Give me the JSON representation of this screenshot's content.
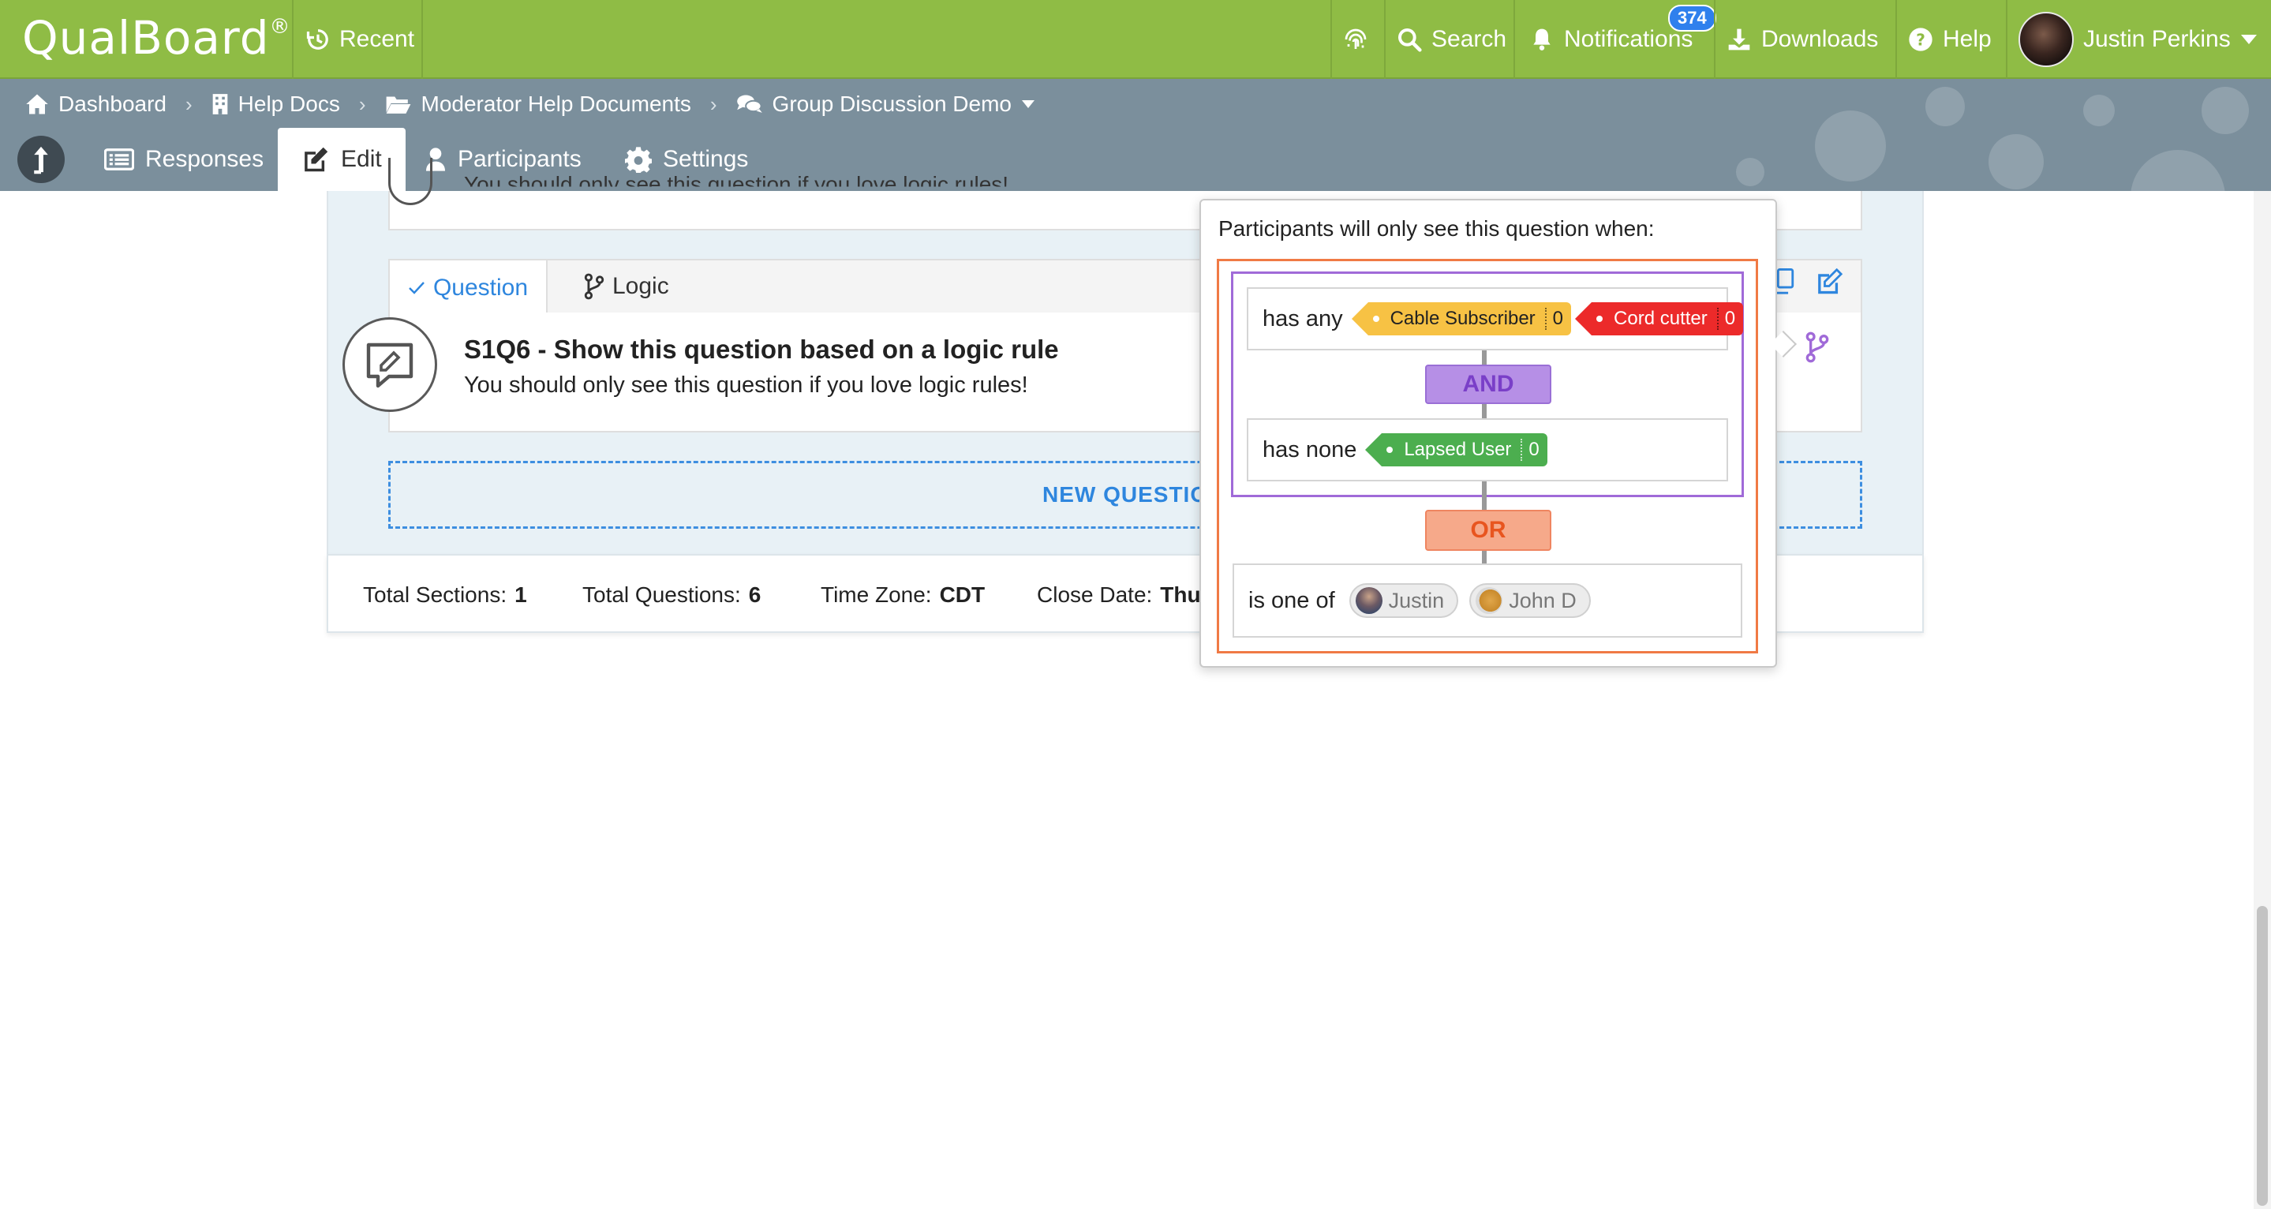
{
  "app": {
    "logo": "QualBoard",
    "logo_mark": "®"
  },
  "topbar": {
    "recent": "Recent",
    "search": "Search",
    "notifications": "Notifications",
    "notifications_count": "374",
    "downloads": "Downloads",
    "help": "Help",
    "user_name": "Justin Perkins"
  },
  "breadcrumb": [
    {
      "label": "Dashboard",
      "icon": "home-icon"
    },
    {
      "label": "Help Docs",
      "icon": "building-icon"
    },
    {
      "label": "Moderator Help Documents",
      "icon": "folder-open-icon"
    },
    {
      "label": "Group Discussion Demo",
      "icon": "comments-icon"
    }
  ],
  "tabs": {
    "responses": "Responses",
    "edit": "Edit",
    "participants": "Participants",
    "settings": "Settings",
    "active": "edit"
  },
  "previous_question": {
    "text": "You should only see this question if you love logic rules!"
  },
  "question": {
    "tab_question": "Question",
    "tab_logic": "Logic",
    "title": "S1Q6 - Show this question based on a logic rule",
    "subtitle": "You should only see this question if you love logic rules!"
  },
  "new_question": {
    "label": "NEW QUESTION"
  },
  "footer": {
    "sections_label": "Total Sections:",
    "sections_value": "1",
    "questions_label": "Total Questions:",
    "questions_value": "6",
    "timezone_label": "Time Zone:",
    "timezone_value": "CDT",
    "close_label": "Close Date:",
    "close_value": "Thu"
  },
  "logic_popover": {
    "title": "Participants will only see this question when:",
    "rule1": {
      "condition": "has any",
      "tags": [
        {
          "label": "Cable Subscriber",
          "count": "0",
          "color": "#f7c244"
        },
        {
          "label": "Cord cutter",
          "count": "0",
          "color": "#ec2a2a"
        }
      ]
    },
    "op_and": "AND",
    "rule2": {
      "condition": "has none",
      "tags": [
        {
          "label": "Lapsed User",
          "count": "0",
          "color": "#4cae4f"
        }
      ]
    },
    "op_or": "OR",
    "rule3": {
      "condition": "is one of",
      "people": [
        {
          "name": "Justin"
        },
        {
          "name": "John D"
        }
      ]
    }
  },
  "colors": {
    "topbar": "#8fbc45",
    "navband": "#7b8f9c",
    "accent": "#2e86de",
    "and_purple": "#a06ad8",
    "or_orange": "#f07a45"
  }
}
